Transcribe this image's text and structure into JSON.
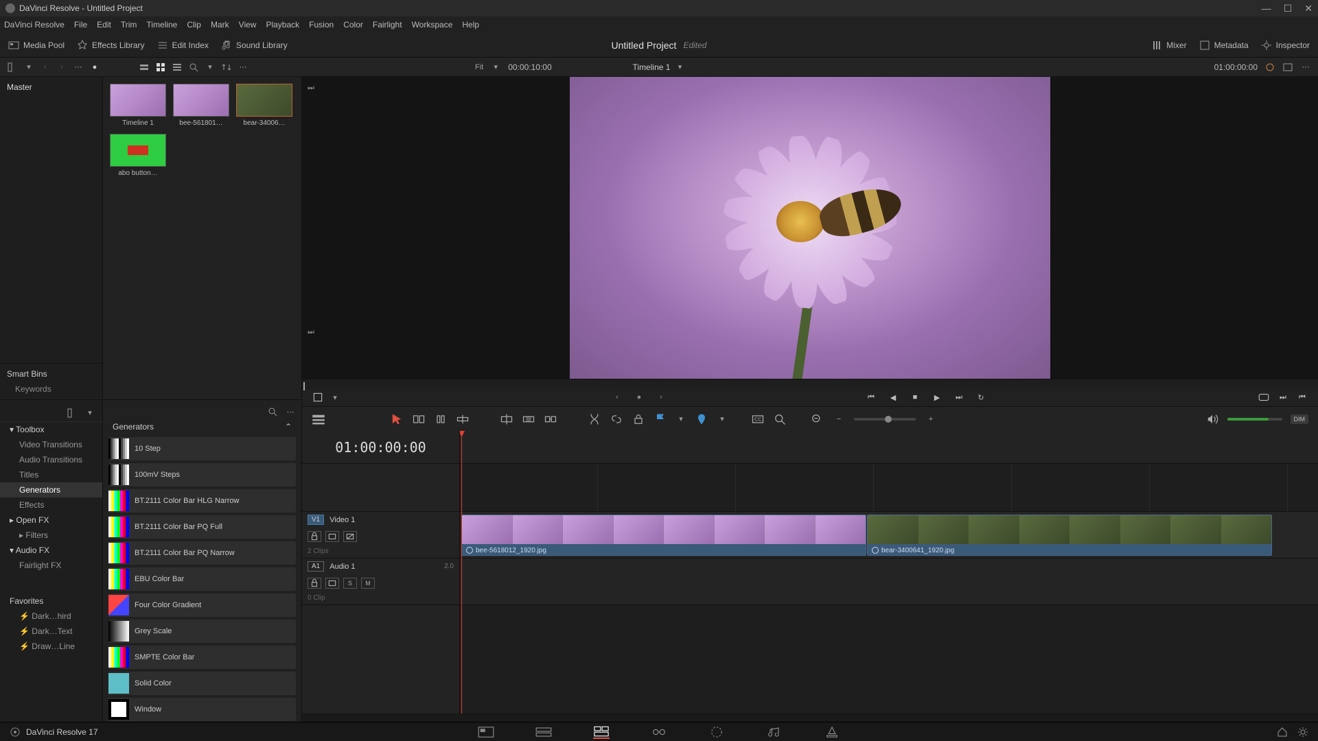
{
  "window": {
    "title": "DaVinci Resolve - Untitled Project"
  },
  "menus": [
    "DaVinci Resolve",
    "File",
    "Edit",
    "Trim",
    "Timeline",
    "Clip",
    "Mark",
    "View",
    "Playback",
    "Fusion",
    "Color",
    "Fairlight",
    "Workspace",
    "Help"
  ],
  "headbar": {
    "media_pool": "Media Pool",
    "effects_library": "Effects Library",
    "edit_index": "Edit Index",
    "sound_library": "Sound Library",
    "mixer": "Mixer",
    "metadata": "Metadata",
    "inspector": "Inspector"
  },
  "project": {
    "title": "Untitled Project",
    "status": "Edited"
  },
  "strip": {
    "fit": "Fit",
    "src_tc": "00:00:10:00",
    "timeline_name": "Timeline 1",
    "rec_tc": "01:00:00:00"
  },
  "bins": {
    "master": "Master",
    "smartbins": "Smart Bins",
    "keywords": "Keywords"
  },
  "pool": {
    "thumbs": [
      {
        "label": "Timeline 1"
      },
      {
        "label": "bee-561801…"
      },
      {
        "label": "bear-34006…"
      },
      {
        "label": "abo button…"
      }
    ]
  },
  "fx": {
    "cats": {
      "toolbox": "Toolbox",
      "video_transitions": "Video Transitions",
      "audio_transitions": "Audio Transitions",
      "titles": "Titles",
      "generators": "Generators",
      "effects": "Effects",
      "openfx": "Open FX",
      "filters": "Filters",
      "audiofx": "Audio FX",
      "fairlightfx": "Fairlight FX",
      "favorites": "Favorites",
      "fav1": "Dark…hird",
      "fav2": "Dark…Text",
      "fav3": "Draw…Line"
    },
    "list_title": "Generators",
    "items": [
      "10 Step",
      "100mV Steps",
      "BT.2111 Color Bar HLG Narrow",
      "BT.2111 Color Bar PQ Full",
      "BT.2111 Color Bar PQ Narrow",
      "EBU Color Bar",
      "Four Color Gradient",
      "Grey Scale",
      "SMPTE Color Bar",
      "Solid Color",
      "Window"
    ]
  },
  "timeline": {
    "tc": "01:00:00:00",
    "v1": {
      "badge": "V1",
      "name": "Video 1",
      "clips": "2 Clips"
    },
    "a1": {
      "badge": "A1",
      "name": "Audio 1",
      "ch": "2.0",
      "clips": "0 Clip",
      "s": "S",
      "m": "M"
    },
    "clip1": "bee-5618012_1920.jpg",
    "clip2": "bear-3400641_1920.jpg"
  },
  "footer": {
    "app": "DaVinci Resolve 17",
    "dim": "DIM"
  }
}
